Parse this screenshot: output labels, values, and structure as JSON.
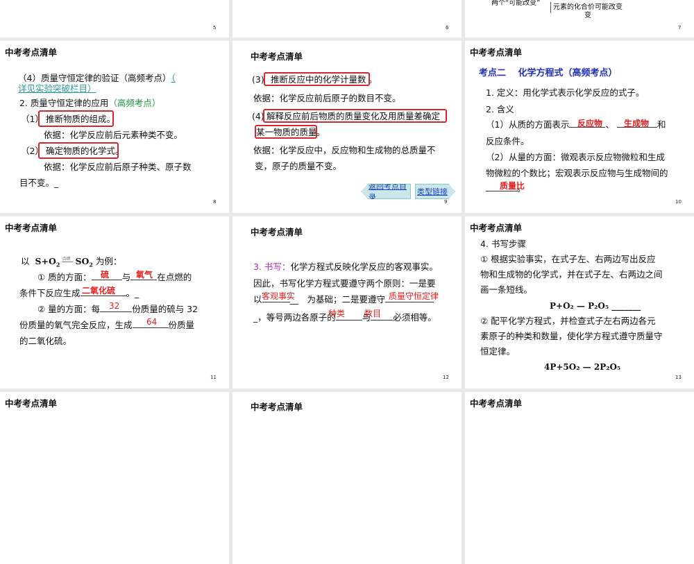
{
  "common_title": "中考考点清单",
  "slides": [
    {
      "number": "5"
    },
    {
      "number": "6"
    },
    {
      "number": "7",
      "lines": [
        "两个“可能改变”",
        "元素的化合价可能改变",
        "变"
      ]
    },
    {
      "number": "8",
      "lines": [
        "（4）质量守恒定律的验证（高频考点）",
        "（",
        "详见实验突破栏目）",
        "2. 质量守恒定律的应用",
        "（高频考点）",
        "（1）",
        "推断物质的组成。",
        "依据：化学反应前后元素种类不变。",
        "（2）",
        "确定物质的化学式。",
        "依据：化学反应前后原子种类、原子数",
        "目不变。_"
      ]
    },
    {
      "number": "9",
      "lines": [
        "(3)",
        "推断反应中的化学计量数",
        "。",
        "依据：化学反应前后原子的数目不变。",
        "(4)",
        "解释反应前后物质的质量变化及用质量差确定",
        "某一物质的质量",
        "。",
        "依据：化学反应中，反应物和生成物的总质量不",
        "变，原子的质量不变。"
      ],
      "buttons": [
        "返回考点目录",
        "类型链接"
      ]
    },
    {
      "number": "10",
      "lines": [
        "考点二　 化学方程式（高频考点）",
        "1. 定义：用化学式表示化学反应的式子。",
        "2. 含义",
        "（1）从质的方面表示",
        "、",
        "和",
        "反应条件。",
        "（2）从量的方面：微观表示反应物微粒和生成",
        "物微粒的个数比；宏观表示反应物与生成物间的",
        "。"
      ],
      "answers": [
        "反应物",
        "生成物",
        "质量比"
      ]
    },
    {
      "number": "11",
      "lines": [
        "以",
        "S+O",
        "2",
        "点燃",
        "SO",
        "2",
        "为例：",
        "① 质的方面：",
        "与",
        "在点燃的",
        "条件下反应生成",
        "。_",
        "② 量的方面：每",
        "份质量的硫与 32",
        "份质量的氧气完全反应，生成",
        "份质量",
        "的二氧化硫。"
      ],
      "answers": [
        "硫",
        "氧气",
        "二氧化硫",
        "32",
        "64"
      ]
    },
    {
      "number": "12",
      "lines": [
        "3. 书写：",
        "化学方程式反映化学反应的客观事实。",
        "因此，书写化学方程式要遵守两个原则：一是要",
        "以",
        "__　为基础；二是要遵守",
        "_，等号两边各原子的",
        "与",
        "必须相等。"
      ],
      "answers": [
        "客观事实",
        "质量守恒定律",
        "种类",
        "数目"
      ]
    },
    {
      "number": "13",
      "lines": [
        "4. 书写步骤",
        "① 根据实验事实，在式子左、右两边写出反应",
        "物和生成物的化学式，并在式子左、右两边之间",
        "画一条短线。",
        "② 配平化学方程式，并检查式子左右两边各元",
        "素原子的种类和数量，使化学方程式遵守质量守",
        "恒定律。"
      ],
      "equations": [
        "P+O₂ — P₂O₅ _______",
        "4P+5O₂ — 2P₂O₅"
      ]
    },
    {},
    {},
    {}
  ]
}
